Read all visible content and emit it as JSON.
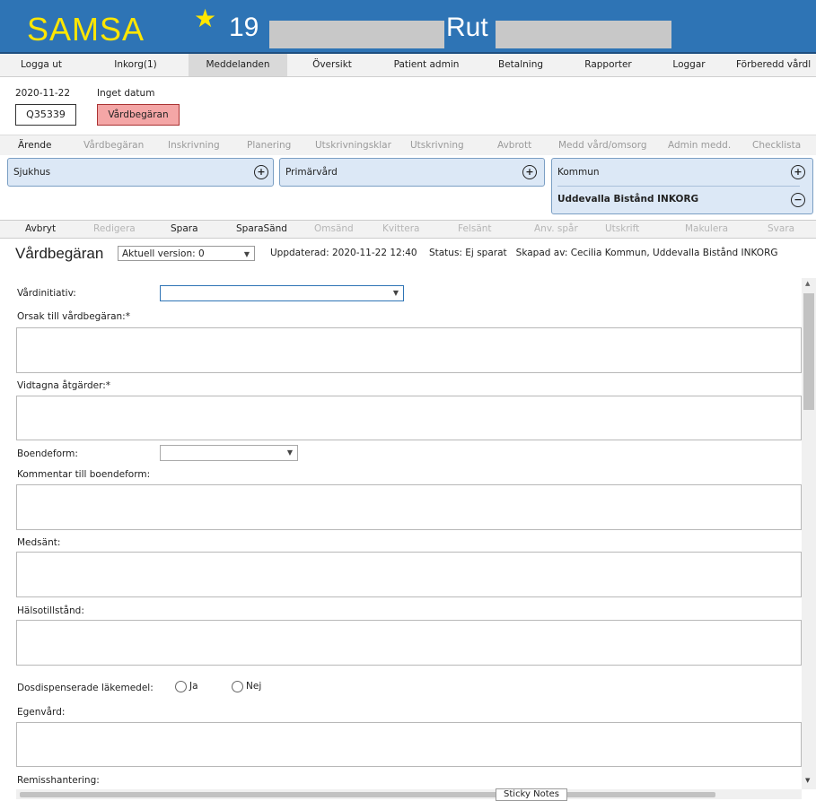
{
  "header": {
    "logo": "SAMSA",
    "patient_number": "19",
    "patient_name": "Rut",
    "colors": {
      "bar": "#2e74b5",
      "logo": "#ffe600"
    }
  },
  "menu": [
    "Logga ut",
    "Inkorg(1)",
    "Meddelanden",
    "Översikt",
    "Patient admin",
    "Betalning",
    "Rapporter",
    "Loggar",
    "Förberedd vårdl"
  ],
  "patient": {
    "date": "2020-11-22",
    "date_status": "Inget datum",
    "id": "Q35339",
    "badge": "Vårdbegäran"
  },
  "tabs": [
    "Ärende",
    "Vårdbegäran",
    "Inskrivning",
    "Planering",
    "Utskrivningsklar",
    "Utskrivning",
    "Avbrott",
    "Medd vård/omsorg",
    "Admin medd.",
    "Checklista"
  ],
  "recipients": {
    "sjukhus": "Sjukhus",
    "primarvard": "Primärvård",
    "kommun": "Kommun",
    "kommun_sub": "Uddevalla Bistånd INKORG"
  },
  "toolbar": [
    "Avbryt",
    "Redigera",
    "Spara",
    "SparaSänd",
    "Omsänd",
    "Kvittera",
    "Felsänt",
    "Anv. spår",
    "Utskrift",
    "Makulera",
    "Svara"
  ],
  "doc": {
    "title": "Vårdbegäran",
    "version": "Aktuell version: 0",
    "updated": "Uppdaterad: 2020-11-22 12:40",
    "status": "Status: Ej sparat",
    "created_by": "Skapad av: Cecilia Kommun, Uddevalla Bistånd INKORG"
  },
  "form": {
    "vardinitiativ": "Vårdinitiativ:",
    "orsak": "Orsak till vårdbegäran:*",
    "vidtagna": "Vidtagna åtgärder:*",
    "boendeform": "Boendeform:",
    "kommentar": "Kommentar till boendeform:",
    "medsant": "Medsänt:",
    "halsotillstand": "Hälsotillstånd:",
    "dosdisp": "Dosdispenserade läkemedel:",
    "ja": "Ja",
    "nej": "Nej",
    "egenvard": "Egenvård:",
    "remiss": "Remisshantering:"
  },
  "sticky_notes": "Sticky Notes"
}
